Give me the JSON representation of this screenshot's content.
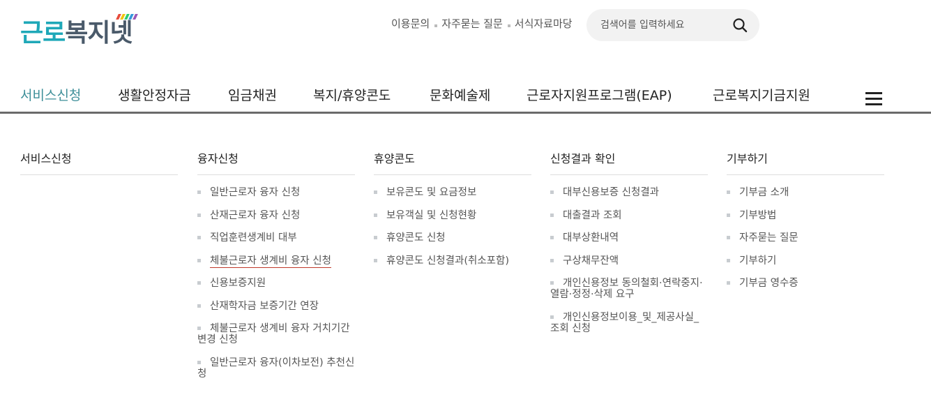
{
  "logo": {
    "part1": "근로",
    "part2": "복지넷",
    "stripe_colors": [
      "#e74c3c",
      "#f1c40f",
      "#2ecc71",
      "#3498db",
      "#9b59b6"
    ]
  },
  "util_links": [
    "이용문의",
    "자주묻는 질문",
    "서식자료마당"
  ],
  "search": {
    "placeholder": "검색어를 입력하세요"
  },
  "gnb": [
    "서비스신청",
    "생활안정자금",
    "임금채권",
    "복지/휴양콘도",
    "문화예술제",
    "근로자지원프로그램(EAP)",
    "근로복지기금지원"
  ],
  "accent_color": "#3e8f99",
  "mega": [
    {
      "title": "서비스신청",
      "items": []
    },
    {
      "title": "융자신청",
      "items": [
        "일반근로자 융자 신청",
        "산재근로자 융자 신청",
        "직업훈련생계비 대부",
        "체불근로자 생계비 융자 신청",
        "신용보증지원",
        "산재학자금 보증기간 연장",
        "체불근로자 생계비 융자 거치기간 변경 신청",
        "일반근로자 융자(이차보전) 추천신청"
      ]
    },
    {
      "title": "휴양콘도",
      "items": [
        "보유콘도 및 요금정보",
        "보유객실 및 신청현황",
        "휴양콘도 신청",
        "휴양콘도 신청결과(취소포함)"
      ]
    },
    {
      "title": "신청결과 확인",
      "items": [
        "대부신용보증 신청결과",
        "대출결과 조회",
        "대부상환내역",
        "구상채무잔액",
        "개인신용정보 동의철회·연락중지·열람·정정·삭제 요구",
        "개인신용정보이용_및_제공사실_조회 신청"
      ]
    },
    {
      "title": "기부하기",
      "items": [
        "기부금 소개",
        "기부방법",
        "자주묻는 질문",
        "기부하기",
        "기부금 영수증"
      ]
    }
  ]
}
